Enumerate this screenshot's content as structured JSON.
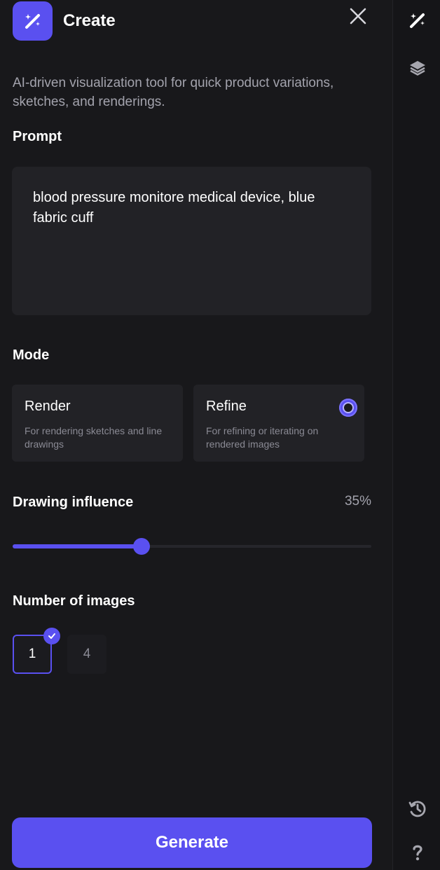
{
  "header": {
    "title": "Create"
  },
  "description": "AI-driven visualization tool for quick product variations, sketches, and renderings.",
  "prompt": {
    "label": "Prompt",
    "value": "blood pressure monitore medical device, blue fabric cuff"
  },
  "mode": {
    "label": "Mode",
    "options": [
      {
        "title": "Render",
        "description": "For rendering sketches and line drawings",
        "selected": false
      },
      {
        "title": "Refine",
        "description": "For refining or iterating on rendered images",
        "selected": true
      }
    ]
  },
  "drawing_influence": {
    "label": "Drawing influence",
    "value_text": "35%",
    "value": 0.35
  },
  "number_of_images": {
    "label": "Number of images",
    "options": [
      "1",
      "4"
    ],
    "selected": "1"
  },
  "actions": {
    "generate_label": "Generate"
  },
  "icons": {
    "app": "magic-wand-icon",
    "close": "close-icon",
    "rail": [
      "magic-wand-icon",
      "layers-icon",
      "history-icon",
      "help-icon"
    ]
  },
  "colors": {
    "accent": "#5a50f0",
    "background": "#18181b",
    "card": "#222226",
    "muted_text": "#a3a3ad"
  }
}
